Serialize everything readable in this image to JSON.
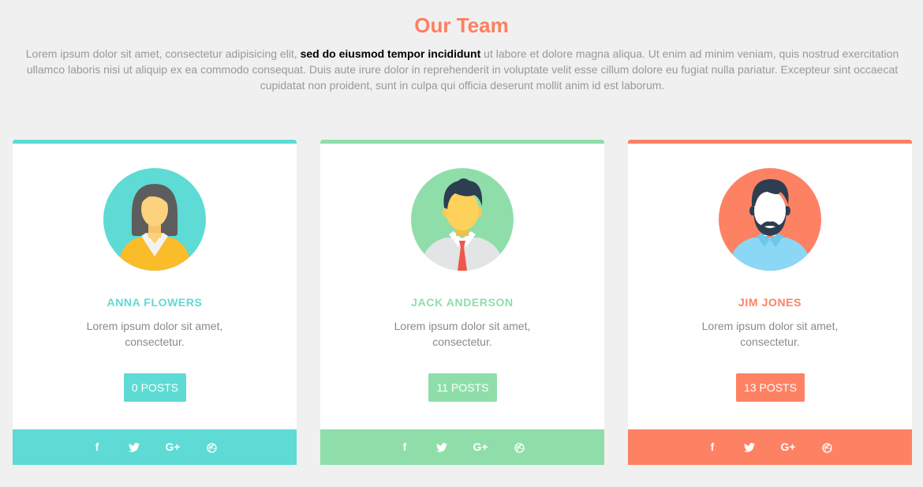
{
  "header": {
    "title": "Our Team",
    "title_color": "#fd7f61",
    "intro_before": "Lorem ipsum dolor sit amet, consectetur adipisicing elit, ",
    "intro_bold": "sed do eiusmod tempor incididunt",
    "intro_after": " ut labore et dolore magna aliqua. Ut enim ad minim veniam, quis nostrud exercitation ullamco laboris nisi ut aliquip ex ea commodo consequat. Duis aute irure dolor in reprehenderit in voluptate velit esse cillum dolore eu fugiat nulla pariatur. Excepteur sint occaecat cupidatat non proident, sunt in culpa qui officia deserunt mollit anim id est laborum."
  },
  "members": [
    {
      "name": "ANNA FLOWERS",
      "description": "Lorem ipsum dolor sit amet, consectetur.",
      "posts_label": "0 POSTS",
      "accent": "#5ddbd4",
      "avatar_icon": "woman-avatar-icon"
    },
    {
      "name": "JACK ANDERSON",
      "description": "Lorem ipsum dolor sit amet, consectetur.",
      "posts_label": "11 POSTS",
      "accent": "#8fdeaa",
      "avatar_icon": "man-with-tie-avatar-icon"
    },
    {
      "name": "JIM JONES",
      "description": "Lorem ipsum dolor sit amet, consectetur.",
      "posts_label": "13 POSTS",
      "accent": "#fd8264",
      "avatar_icon": "bearded-man-avatar-icon"
    }
  ],
  "social": {
    "facebook": "f",
    "twitter_icon": "twitter-bird-icon",
    "googleplus": "G+",
    "dribbble_icon": "dribbble-ball-icon"
  }
}
